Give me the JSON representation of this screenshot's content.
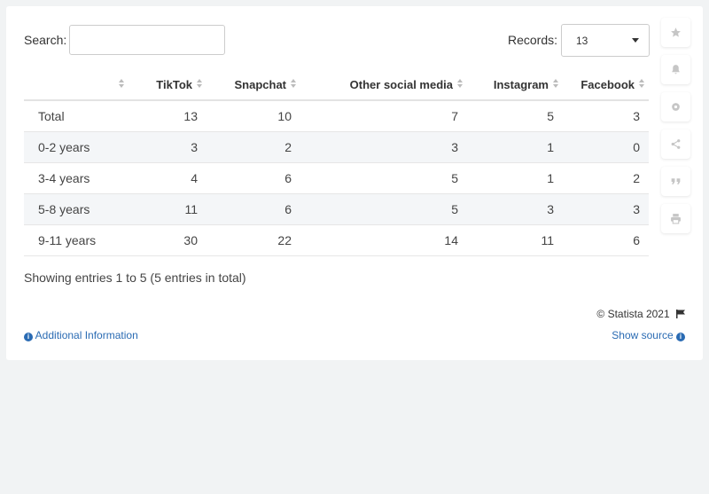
{
  "search": {
    "label": "Search:",
    "value": ""
  },
  "records": {
    "label": "Records:",
    "value": "13"
  },
  "table": {
    "headers": [
      "",
      "TikTok",
      "Snapchat",
      "Other social media",
      "Instagram",
      "Facebook"
    ],
    "rows": [
      [
        "Total",
        "13",
        "10",
        "7",
        "5",
        "3"
      ],
      [
        "0-2 years",
        "3",
        "2",
        "3",
        "1",
        "0"
      ],
      [
        "3-4 years",
        "4",
        "6",
        "5",
        "1",
        "2"
      ],
      [
        "5-8 years",
        "11",
        "6",
        "5",
        "3",
        "3"
      ],
      [
        "9-11 years",
        "30",
        "22",
        "14",
        "11",
        "6"
      ]
    ]
  },
  "footer": {
    "showing": "Showing entries 1 to 5 (5 entries in total)",
    "copyright": "© Statista 2021",
    "additional_info": "Additional Information",
    "show_source": "Show source"
  },
  "toolbar": {
    "icons": [
      "star-icon",
      "bell-icon",
      "gear-icon",
      "share-icon",
      "quote-icon",
      "print-icon"
    ]
  },
  "colors": {
    "link": "#2a6bb3",
    "icon": "#c6c6c6",
    "alt_row": "#f4f6f8"
  }
}
